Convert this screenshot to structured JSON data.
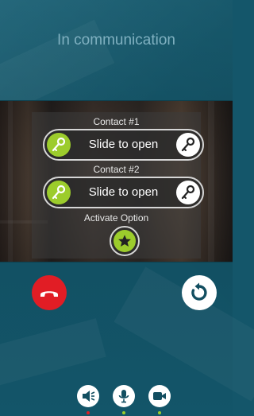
{
  "header": {
    "title": "In communication"
  },
  "video": {
    "contacts": [
      {
        "label": "Contact #1",
        "slider_text": "Slide to open"
      },
      {
        "label": "Contact #2",
        "slider_text": "Slide to open"
      }
    ],
    "activate_label": "Activate Option"
  },
  "call": {
    "hangup_icon": "phone-hangup-icon",
    "redo_icon": "rotate-icon"
  },
  "controls": [
    {
      "icon": "speaker-mute-icon",
      "status_color": "#e11d25"
    },
    {
      "icon": "microphone-icon",
      "status_color": "#9ccc2c"
    },
    {
      "icon": "video-camera-icon",
      "status_color": "#9ccc2c"
    }
  ],
  "colors": {
    "accent_green": "#9ccc2c",
    "hangup_red": "#e11d25",
    "background": "#14566a"
  }
}
